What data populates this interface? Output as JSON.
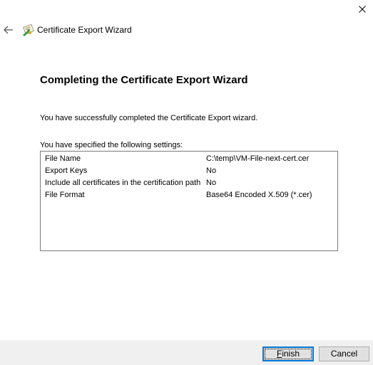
{
  "window": {
    "title": "Certificate Export Wizard",
    "close_icon": "close-icon",
    "back_icon": "back-arrow-icon",
    "wizard_icon": "certificate-wizard-icon"
  },
  "page": {
    "heading": "Completing the Certificate Export Wizard",
    "success_text": "You have successfully completed the Certificate Export wizard.",
    "specified_text": "You have specified the following settings:"
  },
  "settings": [
    {
      "name": "File Name",
      "value": "C:\\temp\\VM-File-next-cert.cer"
    },
    {
      "name": "Export Keys",
      "value": "No"
    },
    {
      "name": "Include all certificates in the certification path",
      "value": "No"
    },
    {
      "name": "File Format",
      "value": "Base64 Encoded X.509 (*.cer)"
    }
  ],
  "buttons": {
    "finish_mnemonic": "F",
    "finish_rest": "inish",
    "cancel": "Cancel"
  },
  "colors": {
    "accent": "#0078d7",
    "footer_bg": "#f0f0f0",
    "border": "#7a7a7a"
  }
}
